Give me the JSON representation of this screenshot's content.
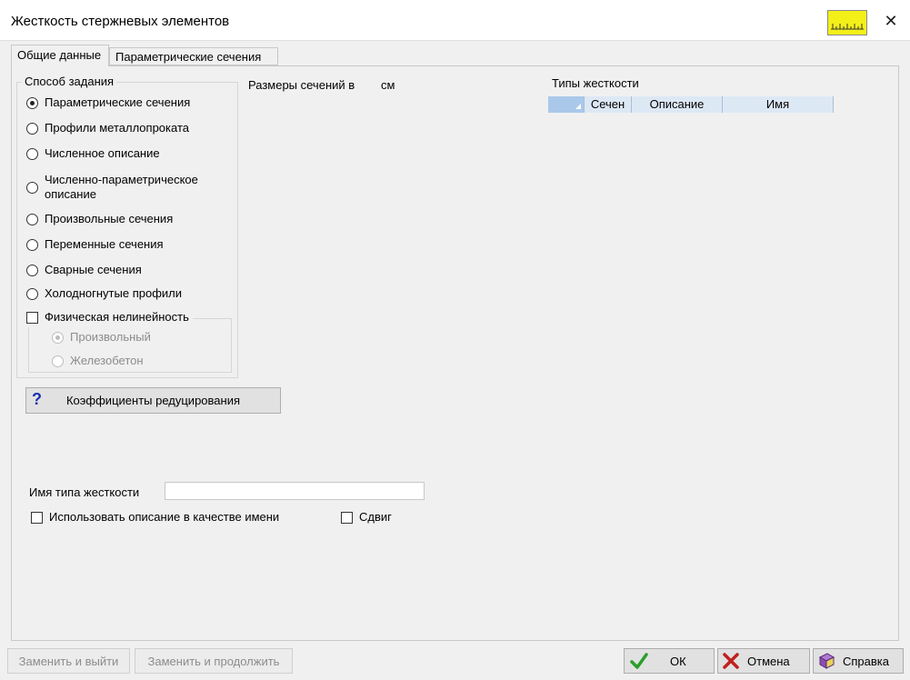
{
  "window": {
    "title": "Жесткость стержневых элементов",
    "close_glyph": "✕"
  },
  "tabs": [
    {
      "label": "Общие данные",
      "active": true
    },
    {
      "label": "Параметрические сечения",
      "active": false
    }
  ],
  "method_group": {
    "legend": "Способ задания",
    "options": [
      {
        "label": "Параметрические сечения",
        "selected": true
      },
      {
        "label": "Профили металлопроката",
        "selected": false
      },
      {
        "label": "Численное описание",
        "selected": false
      },
      {
        "label": "Численно-параметрическое описание",
        "selected": false
      },
      {
        "label": "Произвольные сечения",
        "selected": false
      },
      {
        "label": "Переменные сечения",
        "selected": false
      },
      {
        "label": "Сварные сечения",
        "selected": false
      },
      {
        "label": "Холодногнутые профили",
        "selected": false
      }
    ],
    "nonlinearity": {
      "label": "Физическая нелинейность",
      "checked": false,
      "options": [
        {
          "label": "Произвольный",
          "selected": true,
          "enabled": false
        },
        {
          "label": "Железобетон",
          "selected": false,
          "enabled": false
        }
      ]
    }
  },
  "sizes": {
    "label": "Размеры сечений в",
    "unit": "см"
  },
  "coef_button": {
    "label": "Коэффициенты редуцирования",
    "icon": "help-question-icon"
  },
  "stiffness_types": {
    "title": "Типы жесткости",
    "columns": [
      "",
      "Сечен",
      "Описание",
      "Имя"
    ],
    "rows": []
  },
  "name_field": {
    "label": "Имя типа жесткости",
    "value": ""
  },
  "use_description": {
    "label": "Использовать описание в качестве имени",
    "checked": false
  },
  "shear": {
    "label": "Сдвиг",
    "checked": false
  },
  "footer": {
    "replace_exit": "Заменить и выйти",
    "replace_continue": "Заменить и продолжить",
    "ok": "ОК",
    "cancel": "Отмена",
    "help": "Справка"
  },
  "colors": {
    "check_green": "#2a9d2a",
    "cancel_red": "#c0201e",
    "ruler_yellow": "#f3ef18",
    "header_blue": "#dde8f5"
  }
}
